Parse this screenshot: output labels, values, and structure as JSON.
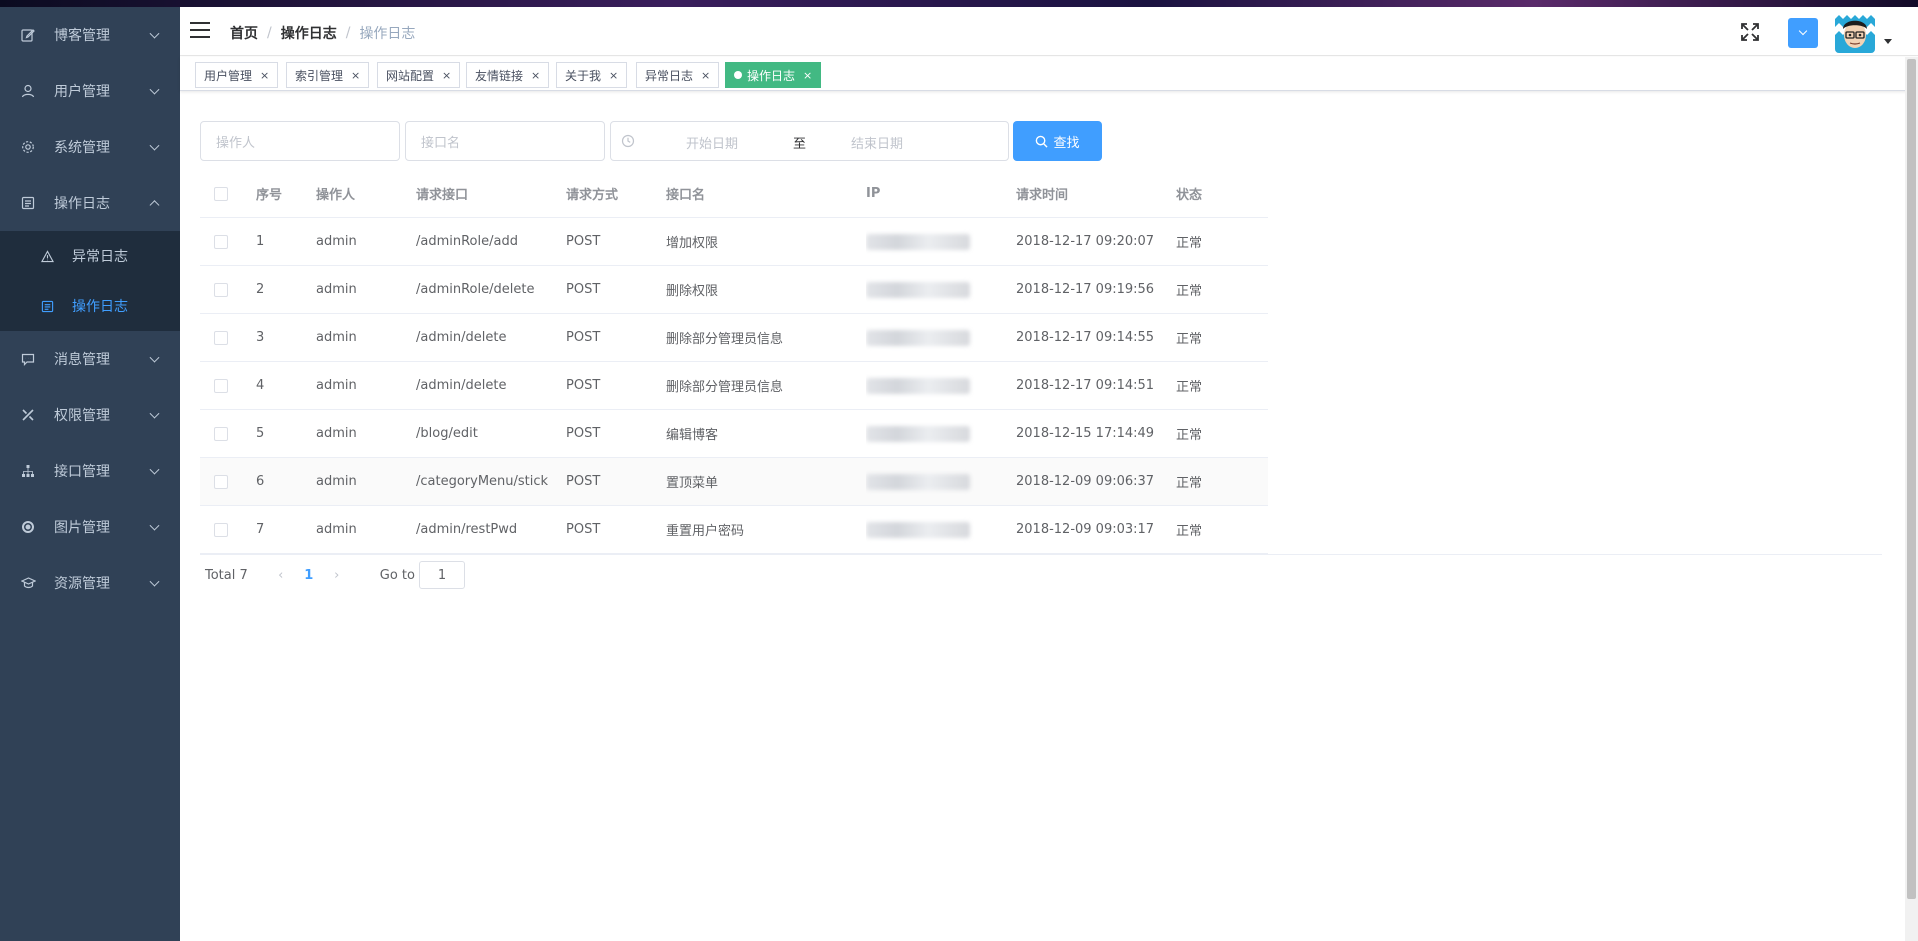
{
  "sidebar": {
    "items": [
      {
        "label": "博客管理",
        "icon": "edit-icon"
      },
      {
        "label": "用户管理",
        "icon": "user-icon"
      },
      {
        "label": "系统管理",
        "icon": "gear-icon"
      },
      {
        "label": "操作日志",
        "icon": "log-icon",
        "expanded": true,
        "children": [
          {
            "label": "异常日志",
            "icon": "warning-icon"
          },
          {
            "label": "操作日志",
            "icon": "document-icon",
            "active": true
          }
        ]
      },
      {
        "label": "消息管理",
        "icon": "message-icon"
      },
      {
        "label": "权限管理",
        "icon": "tools-icon"
      },
      {
        "label": "接口管理",
        "icon": "sitemap-icon"
      },
      {
        "label": "图片管理",
        "icon": "picture-icon"
      },
      {
        "label": "资源管理",
        "icon": "graduation-icon"
      }
    ]
  },
  "header": {
    "breadcrumb": [
      "首页",
      "操作日志",
      "操作日志"
    ]
  },
  "tags": [
    {
      "label": "用户管理"
    },
    {
      "label": "索引管理"
    },
    {
      "label": "网站配置"
    },
    {
      "label": "友情链接"
    },
    {
      "label": "关于我"
    },
    {
      "label": "异常日志"
    },
    {
      "label": "操作日志",
      "active": true
    }
  ],
  "filters": {
    "operator_placeholder": "操作人",
    "api_name_placeholder": "接口名",
    "start_date_placeholder": "开始日期",
    "range_separator": "至",
    "end_date_placeholder": "结束日期",
    "search_label": "查找"
  },
  "table": {
    "columns": [
      "序号",
      "操作人",
      "请求接口",
      "请求方式",
      "接口名",
      "IP",
      "请求时间",
      "状态"
    ],
    "rows": [
      {
        "index": "1",
        "operator": "admin",
        "url": "/adminRole/add",
        "method": "POST",
        "name": "增加权限",
        "time": "2018-12-17 09:20:07",
        "status": "正常"
      },
      {
        "index": "2",
        "operator": "admin",
        "url": "/adminRole/delete",
        "method": "POST",
        "name": "删除权限",
        "time": "2018-12-17 09:19:56",
        "status": "正常"
      },
      {
        "index": "3",
        "operator": "admin",
        "url": "/admin/delete",
        "method": "POST",
        "name": "删除部分管理员信息",
        "time": "2018-12-17 09:14:55",
        "status": "正常"
      },
      {
        "index": "4",
        "operator": "admin",
        "url": "/admin/delete",
        "method": "POST",
        "name": "删除部分管理员信息",
        "time": "2018-12-17 09:14:51",
        "status": "正常"
      },
      {
        "index": "5",
        "operator": "admin",
        "url": "/blog/edit",
        "method": "POST",
        "name": "编辑博客",
        "time": "2018-12-15 17:14:49",
        "status": "正常"
      },
      {
        "index": "6",
        "operator": "admin",
        "url": "/categoryMenu/stick",
        "method": "POST",
        "name": "置顶菜单",
        "time": "2018-12-09 09:06:37",
        "status": "正常"
      },
      {
        "index": "7",
        "operator": "admin",
        "url": "/admin/restPwd",
        "method": "POST",
        "name": "重置用户密码",
        "time": "2018-12-09 09:03:17",
        "status": "正常"
      }
    ]
  },
  "pagination": {
    "total": "Total 7",
    "current_page": "1",
    "goto_label": "Go to",
    "goto_value": "1"
  },
  "colors": {
    "sidebar_bg": "#304156",
    "sidebar_sub_bg": "#1f2d3d",
    "primary": "#409eff",
    "active_tag": "#42b983"
  }
}
